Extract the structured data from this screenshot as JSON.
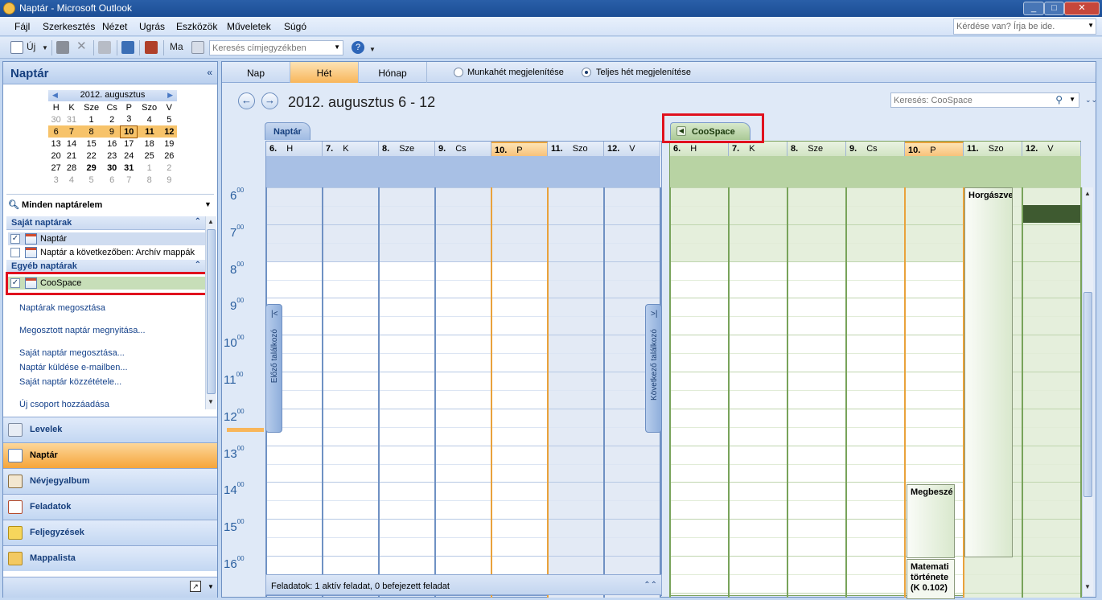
{
  "window": {
    "title": "Naptár - Microsoft Outlook"
  },
  "menu": {
    "items": [
      "Fájl",
      "Szerkesztés",
      "Nézet",
      "Ugrás",
      "Eszközök",
      "Műveletek",
      "Súgó"
    ],
    "help_placeholder": "Kérdése van? Írja be ide."
  },
  "toolbar": {
    "new_label": "Új",
    "address_label": "Ma",
    "address_search_placeholder": "Keresés címjegyzékben"
  },
  "nav": {
    "title": "Naptár",
    "minical": {
      "month": "2012. augusztus",
      "weekdays": [
        "H",
        "K",
        "Sze",
        "Cs",
        "P",
        "Szo",
        "V"
      ],
      "weeks": [
        [
          "30",
          "31",
          "1",
          "2",
          "3",
          "4",
          "5"
        ],
        [
          "6",
          "7",
          "8",
          "9",
          "10",
          "11",
          "12"
        ],
        [
          "13",
          "14",
          "15",
          "16",
          "17",
          "18",
          "19"
        ],
        [
          "20",
          "21",
          "22",
          "23",
          "24",
          "25",
          "26"
        ],
        [
          "27",
          "28",
          "29",
          "30",
          "31",
          "1",
          "2"
        ],
        [
          "3",
          "4",
          "5",
          "6",
          "7",
          "8",
          "9"
        ]
      ]
    },
    "all_items_label": "Minden naptárelem",
    "own_group": "Saját naptárak",
    "own_items": [
      "Naptár",
      "Naptár a következőben: Archív mappák"
    ],
    "other_group": "Egyéb naptárak",
    "other_items": [
      "CooSpace"
    ],
    "links": [
      "Naptárak megosztása",
      "Megosztott naptár megnyitása...",
      "Saját naptár megosztása...",
      "Naptár küldése e-mailben...",
      "Saját naptár közzététele...",
      "Új csoport hozzáadása"
    ],
    "buttons": [
      "Levelek",
      "Naptár",
      "Névjegyalbum",
      "Feladatok",
      "Feljegyzések",
      "Mappalista"
    ]
  },
  "view": {
    "tabs": [
      "Nap",
      "Hét",
      "Hónap"
    ],
    "active_tab": "Hét",
    "radio_workweek": "Munkahét megjelenítése",
    "radio_fullweek": "Teljes hét megjelenítése",
    "date_range": "2012. augusztus 6 - 12",
    "search_placeholder": "Keresés: CooSpace"
  },
  "calendar": {
    "hours": [
      "6",
      "7",
      "8",
      "9",
      "10",
      "11",
      "12",
      "13",
      "14",
      "15",
      "16"
    ],
    "hour_suffix": "00",
    "days": [
      {
        "num": "6.",
        "name": "H"
      },
      {
        "num": "7.",
        "name": "K"
      },
      {
        "num": "8.",
        "name": "Sze"
      },
      {
        "num": "9.",
        "name": "Cs"
      },
      {
        "num": "10.",
        "name": "P"
      },
      {
        "num": "11.",
        "name": "Szo"
      },
      {
        "num": "12.",
        "name": "V"
      }
    ],
    "left_tab": "Naptár",
    "right_tab": "CooSpace",
    "prev_label": "Előző találkozó",
    "next_label": "Következő találkozó",
    "appointments": [
      "Horgászve",
      "Megbeszé",
      "Matemati története (K 0.102)"
    ],
    "tasks": "Feladatok: 1 aktív feladat, 0 befejezett feladat"
  },
  "colors": {
    "accent": "#f8b65a",
    "naptar_bg": "#e6edf8",
    "coospace_bg": "#e5efdc",
    "highlight_red": "#e0111e"
  }
}
